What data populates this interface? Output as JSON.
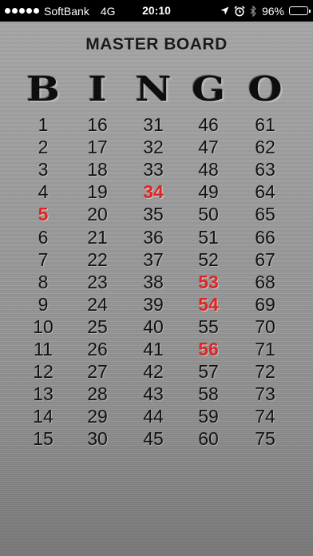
{
  "status_bar": {
    "carrier": "SoftBank",
    "network": "4G",
    "time": "20:10",
    "battery_percent": "96%",
    "battery_level": 0.96,
    "icons": [
      "location-arrow-icon",
      "alarm-clock-icon",
      "bluetooth-icon",
      "battery-icon"
    ]
  },
  "board": {
    "title": "MASTER BOARD",
    "letters": [
      "B",
      "I",
      "N",
      "G",
      "O"
    ],
    "called_color": "#e02424",
    "columns": [
      {
        "letter": "B",
        "numbers": [
          "1",
          "2",
          "3",
          "4",
          "5",
          "6",
          "7",
          "8",
          "9",
          "10",
          "11",
          "12",
          "13",
          "14",
          "15"
        ]
      },
      {
        "letter": "I",
        "numbers": [
          "16",
          "17",
          "18",
          "19",
          "20",
          "21",
          "22",
          "23",
          "24",
          "25",
          "26",
          "27",
          "28",
          "29",
          "30"
        ]
      },
      {
        "letter": "N",
        "numbers": [
          "31",
          "32",
          "33",
          "34",
          "35",
          "36",
          "37",
          "38",
          "39",
          "40",
          "41",
          "42",
          "43",
          "44",
          "45"
        ]
      },
      {
        "letter": "G",
        "numbers": [
          "46",
          "47",
          "48",
          "49",
          "50",
          "51",
          "52",
          "53",
          "54",
          "55",
          "56",
          "57",
          "58",
          "59",
          "60"
        ]
      },
      {
        "letter": "O",
        "numbers": [
          "61",
          "62",
          "63",
          "64",
          "65",
          "66",
          "67",
          "68",
          "69",
          "70",
          "71",
          "72",
          "73",
          "74",
          "75"
        ]
      }
    ],
    "called_numbers": [
      "5",
      "34",
      "53",
      "54",
      "56"
    ]
  }
}
